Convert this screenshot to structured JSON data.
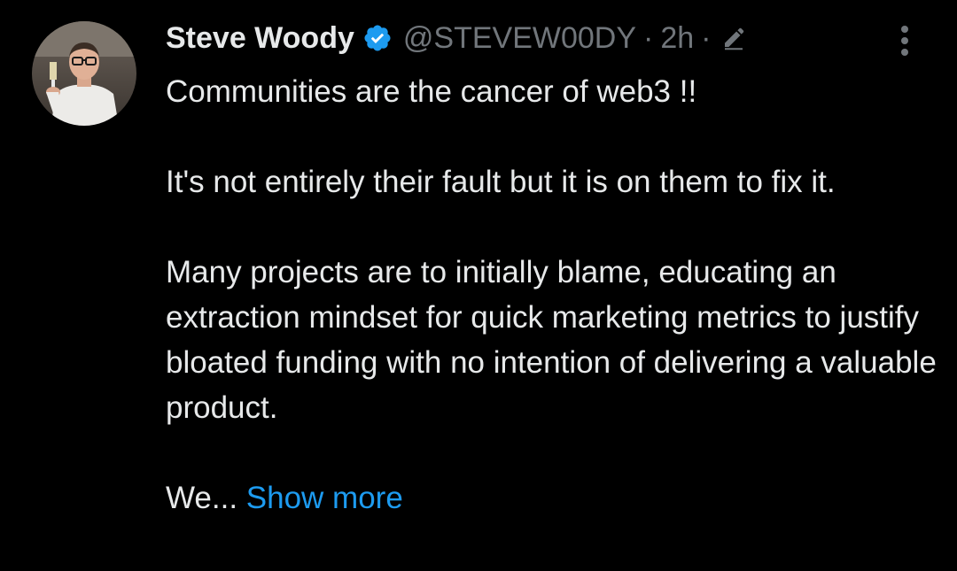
{
  "tweet": {
    "author": {
      "display_name": "Steve Woody",
      "handle": "@STEVEW00DY",
      "verified": true,
      "verified_icon": "verified-badge-icon",
      "avatar_alt": "profile photo"
    },
    "meta": {
      "separator": "·",
      "time": "2h",
      "edited_icon": "pencil-icon"
    },
    "more_icon": "more-vertical-icon",
    "body": {
      "paragraph_1": "Communities are the cancer of web3 !!",
      "paragraph_2": "It's not entirely their fault but it is on them to fix it.",
      "paragraph_3": "Many projects are to initially blame, educating an extraction mindset for quick marketing metrics to justify bloated funding with no intention of delivering a valuable product.",
      "paragraph_4_truncated": "We...",
      "show_more_label": "Show more"
    }
  },
  "colors": {
    "background": "#000000",
    "primary_text": "#e7e9ea",
    "secondary_text": "#71767b",
    "accent": "#1d9bf0"
  }
}
